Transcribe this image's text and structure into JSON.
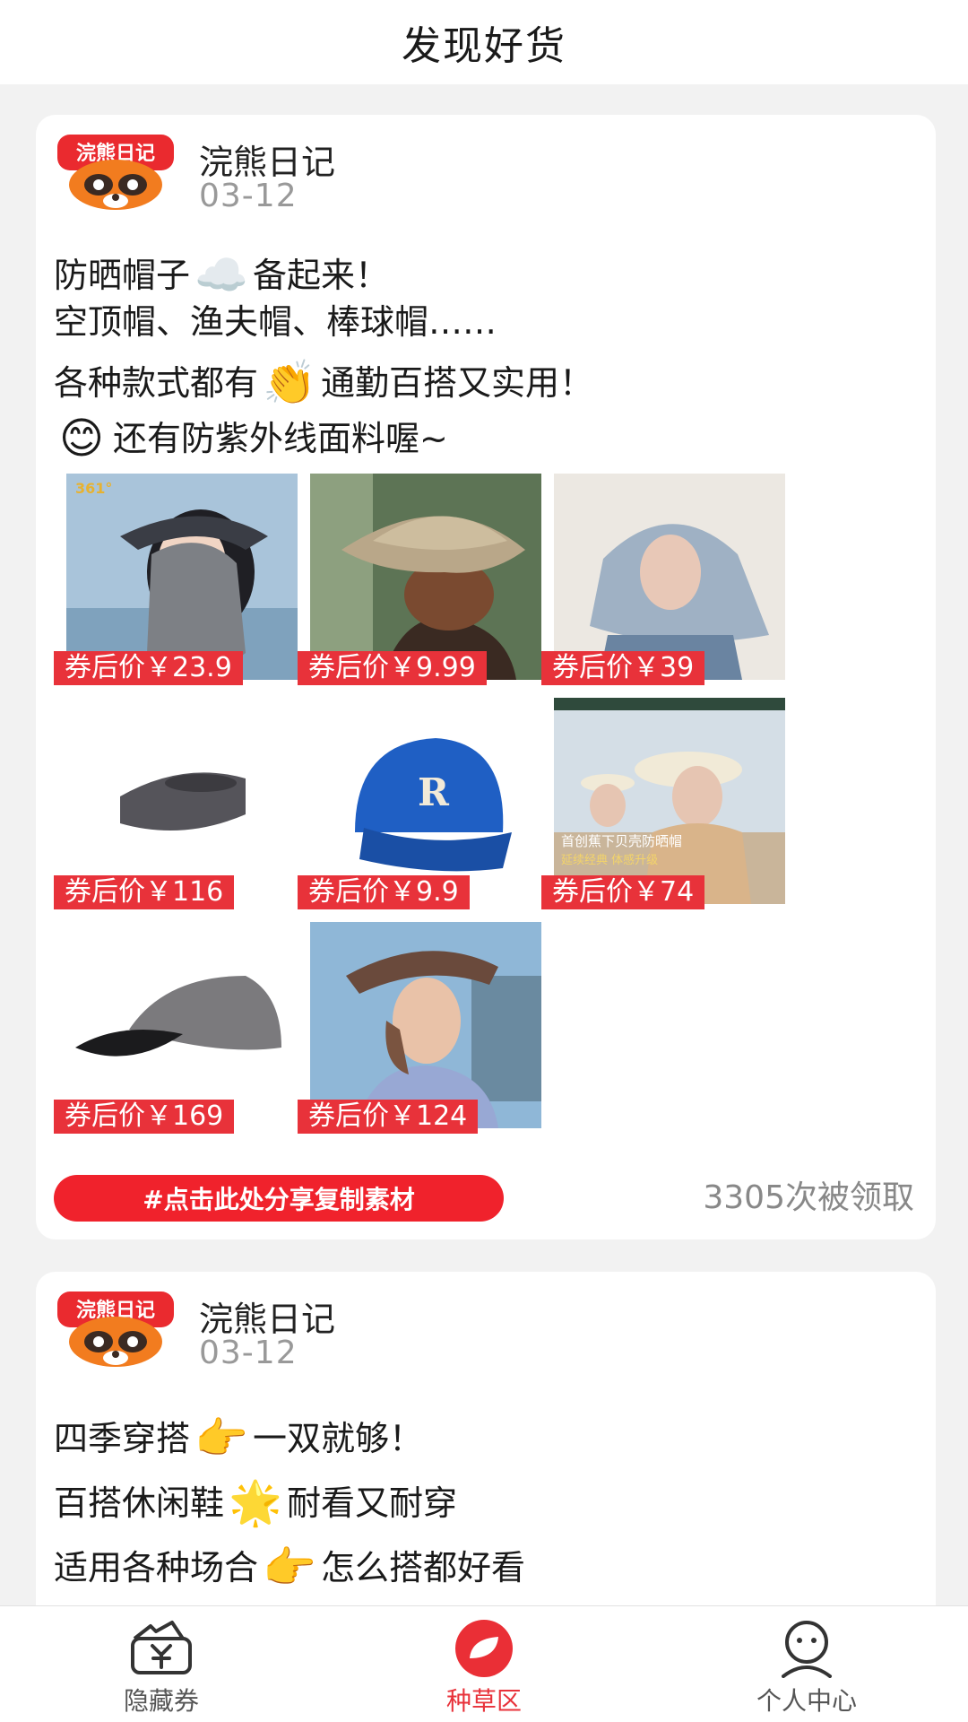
{
  "header": {
    "title": "发现好货"
  },
  "posts": [
    {
      "author": "浣熊日记",
      "avatar_text": "浣熊日记",
      "date": "03-12",
      "lines": [
        {
          "before": "防晒帽子",
          "emoji": "☁️",
          "after": "备起来！"
        },
        {
          "before": "空顶帽、渔夫帽、棒球帽……",
          "emoji": "",
          "after": ""
        },
        {
          "before": "各种款式都有",
          "emoji": "👏",
          "after": "通勤百搭又实用！"
        },
        {
          "before": "",
          "emoji": "😊",
          "after": "还有防紫外线面料喔~"
        }
      ],
      "products": [
        {
          "price": "券后价￥23.9"
        },
        {
          "price": "券后价￥9.99"
        },
        {
          "price": "券后价￥39"
        },
        {
          "price": "券后价￥116"
        },
        {
          "price": "券后价￥9.9"
        },
        {
          "price": "券后价￥74"
        },
        {
          "price": "券后价￥169"
        },
        {
          "price": "券后价￥124"
        }
      ],
      "product_texts": {
        "brand_361": "361°",
        "cap_letter": "R",
        "promo_1": "首创蕉下贝壳防晒帽",
        "promo_2": "延续经典 体感升级"
      },
      "share_label": "#点击此处分享复制素材",
      "claim_count": "3305次被领取"
    },
    {
      "author": "浣熊日记",
      "avatar_text": "浣熊日记",
      "date": "03-12",
      "lines": [
        {
          "before": "四季穿搭",
          "emoji": "👉",
          "after": "一双就够！"
        },
        {
          "before": "百搭休闲鞋",
          "emoji": "🌟",
          "after": "耐看又耐穿"
        },
        {
          "before": "适用各种场合",
          "emoji": "👉",
          "after": "怎么搭都好看"
        }
      ]
    }
  ],
  "bottom_nav": [
    {
      "label": "隐藏券",
      "icon": "wallet-yen-icon",
      "active": false
    },
    {
      "label": "种草区",
      "icon": "leaf-icon",
      "active": true
    },
    {
      "label": "个人中心",
      "icon": "person-icon",
      "active": false
    }
  ],
  "colors": {
    "accent": "#e8323a",
    "share_button": "#f0222c"
  }
}
